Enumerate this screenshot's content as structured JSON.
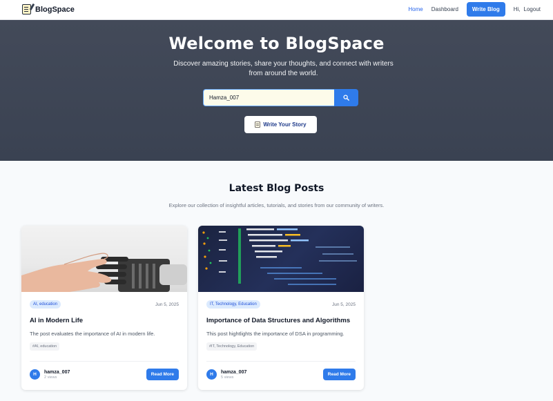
{
  "navbar": {
    "brand": "BlogSpace",
    "links": {
      "home": "Home",
      "dashboard": "Dashboard",
      "write_blog": "Write Blog",
      "greeting": "Hi,",
      "logout": "Logout"
    }
  },
  "hero": {
    "title": "Welcome to BlogSpace",
    "subtitle": "Discover amazing stories, share your thoughts, and connect with writers from around the world.",
    "search": {
      "value": "Hamza_007",
      "placeholder": ""
    },
    "cta_label": "Write Your Story"
  },
  "section": {
    "title": "Latest Blog Posts",
    "subtitle": "Explore our collection of insightful articles, tutorials, and stories from our community of writers."
  },
  "posts": [
    {
      "category": "AI, education",
      "date": "Jun 5, 2025",
      "title": "AI in Modern Life",
      "description": "The post evaluates the importance of AI in modern life.",
      "tags": "#AI, education",
      "author_initial": "H",
      "author": "hamza_007",
      "views": "2 views",
      "read_more": "Read More"
    },
    {
      "category": "IT, Technology, Education",
      "date": "Jun 5, 2025",
      "title": "Importance of Data Structures and Algorithms",
      "description": "This post hightlights the importance of DSA in programming.",
      "tags": "#IT, Technology, Education",
      "author_initial": "H",
      "author": "hamza_007",
      "views": "5 views",
      "read_more": "Read More"
    }
  ],
  "colors": {
    "accent": "#2f7bea",
    "hero_bg": "#3f4656",
    "search_bg": "#fdfbea"
  }
}
